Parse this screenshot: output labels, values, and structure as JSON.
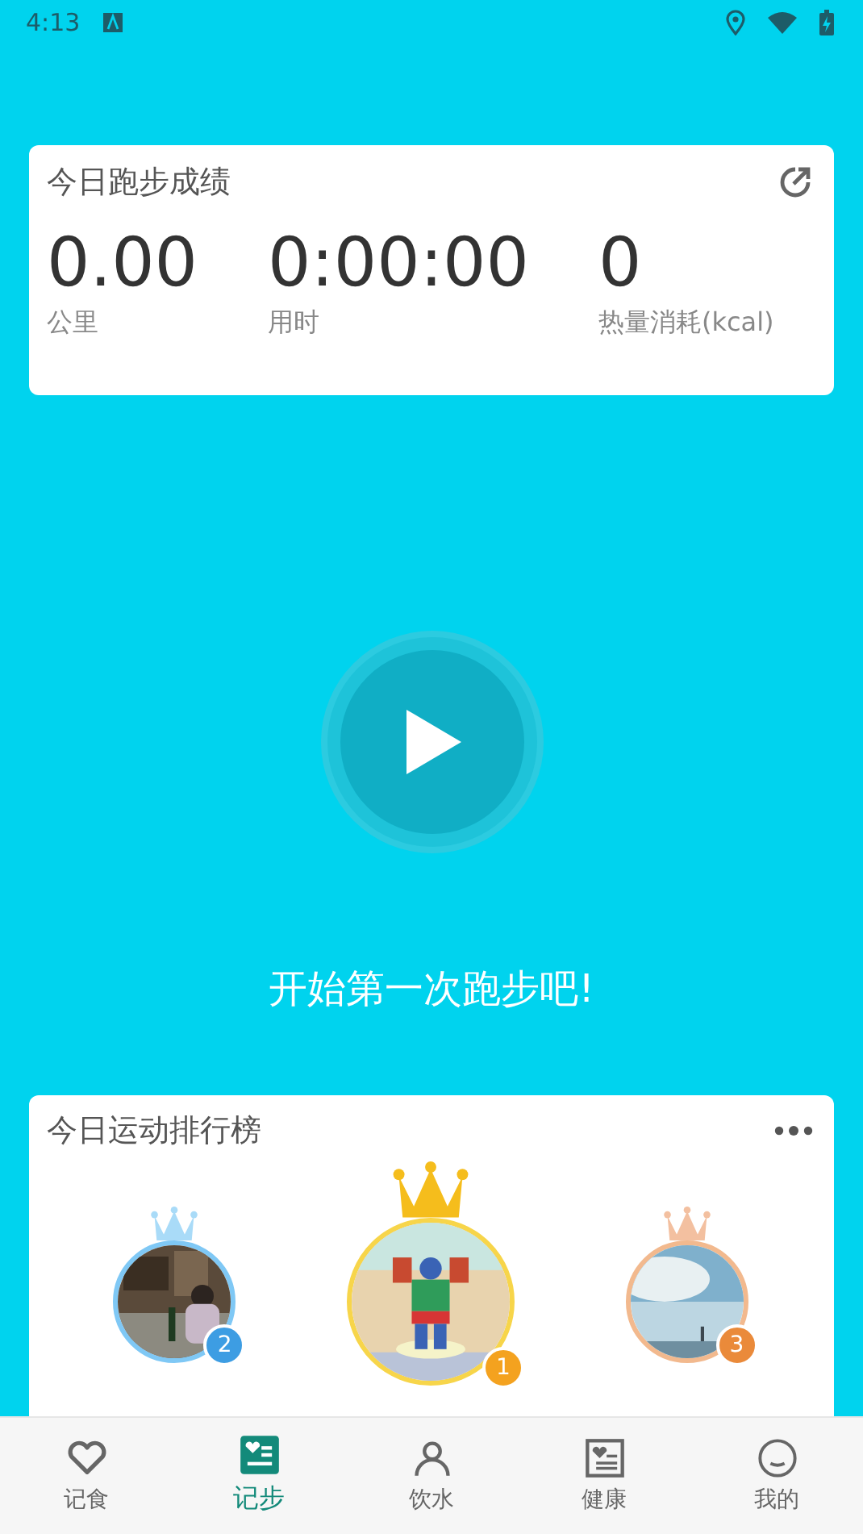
{
  "status_bar": {
    "time": "4:13"
  },
  "run_card": {
    "title": "今日跑步成绩",
    "stats": [
      {
        "value": "0.00",
        "label": "公里"
      },
      {
        "value": "0:00:00",
        "label": "用时"
      },
      {
        "value": "0",
        "label": "热量消耗(kcal)"
      }
    ]
  },
  "start_prompt": "开始第一次跑步吧!",
  "leaderboard": {
    "title": "今日运动排行榜",
    "podium": [
      {
        "rank": "2",
        "kind": "silver"
      },
      {
        "rank": "1",
        "kind": "gold"
      },
      {
        "rank": "3",
        "kind": "bronze"
      }
    ]
  },
  "tab_bar": [
    {
      "label": "记食",
      "kind": "heart",
      "selected": false
    },
    {
      "label": "记步",
      "kind": "steps",
      "selected": true
    },
    {
      "label": "饮水",
      "kind": "person",
      "selected": false
    },
    {
      "label": "健康",
      "kind": "health",
      "selected": false
    },
    {
      "label": "我的",
      "kind": "smile",
      "selected": false
    }
  ]
}
